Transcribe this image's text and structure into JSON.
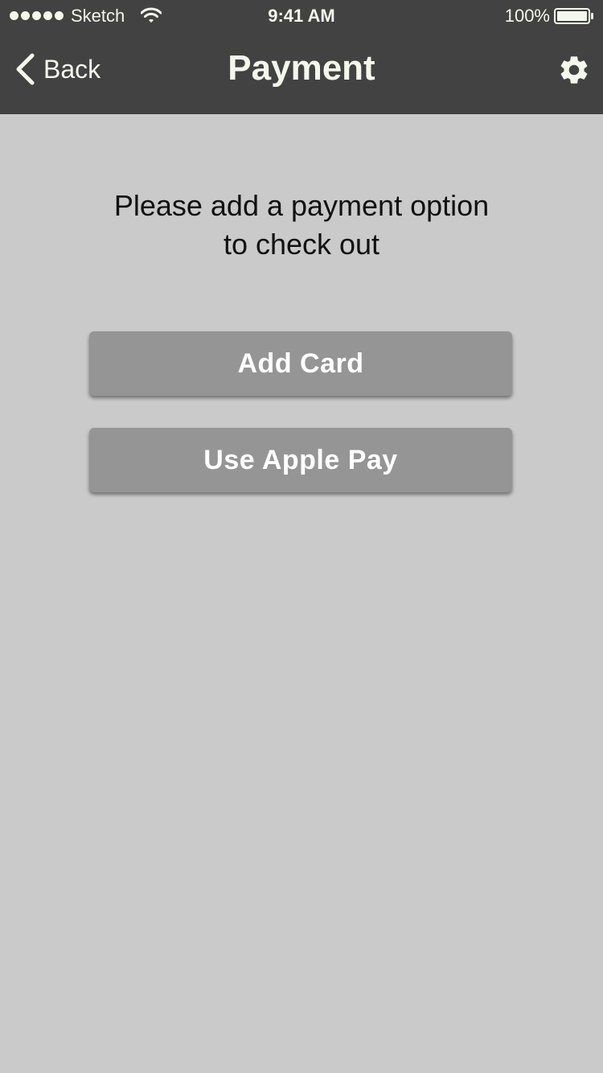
{
  "status_bar": {
    "carrier": "Sketch",
    "time": "9:41 AM",
    "battery": "100%"
  },
  "nav": {
    "back_label": "Back",
    "title": "Payment",
    "settings_icon": "gear-icon"
  },
  "main": {
    "prompt_line1": "Please add a payment option",
    "prompt_line2": "to check out",
    "add_card_label": "Add Card",
    "apple_pay_label": "Use Apple Pay"
  },
  "colors": {
    "nav_background": "#424242",
    "nav_text": "#f4f7ec",
    "page_background": "#cacaca",
    "button_background": "#959595",
    "button_text": "#ffffff"
  }
}
